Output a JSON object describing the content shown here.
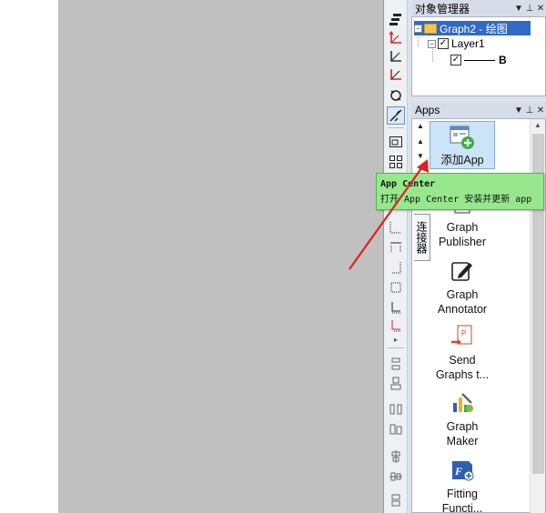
{
  "object_manager": {
    "title": "对象管理器",
    "controls": {
      "dropdown": "▼",
      "pin": "⊥",
      "close": "✕"
    },
    "tree": {
      "graph": {
        "label": "Graph2 - 绘图",
        "expander": "−"
      },
      "layer": {
        "label": "Layer1",
        "expander": "−",
        "checked": "✓"
      },
      "plot": {
        "label": "B",
        "checked": "✓"
      }
    }
  },
  "apps_panel": {
    "title": "Apps",
    "controls": {
      "dropdown": "▼",
      "pin": "⊥",
      "close": "✕"
    },
    "scroll_up_top": "▲",
    "scroll_up": "▲",
    "scroll_down": "▼",
    "scroll_down_bottom": "▼",
    "side_tab": "连接器",
    "items": [
      {
        "label": "添加App",
        "icon": "add-app-icon",
        "selected": true
      },
      {
        "label": "Graph Publisher",
        "icon": "graph-publisher-icon"
      },
      {
        "label": "Graph Annotator",
        "icon": "pencil-icon"
      },
      {
        "label": "Send Graphs t...",
        "icon": "send-ppt-icon"
      },
      {
        "label": "Graph Maker",
        "icon": "graph-maker-icon"
      },
      {
        "label": "Fitting Functi...",
        "icon": "fitting-function-icon"
      }
    ]
  },
  "tooltip": {
    "title": "App Center",
    "body": "打开 App Center 安装并更新 app"
  },
  "colors": {
    "canvas": "#c0c0c0",
    "tooltip_bg": "#97e88d",
    "selection": "#3169c6",
    "arrow": "#e02020"
  }
}
